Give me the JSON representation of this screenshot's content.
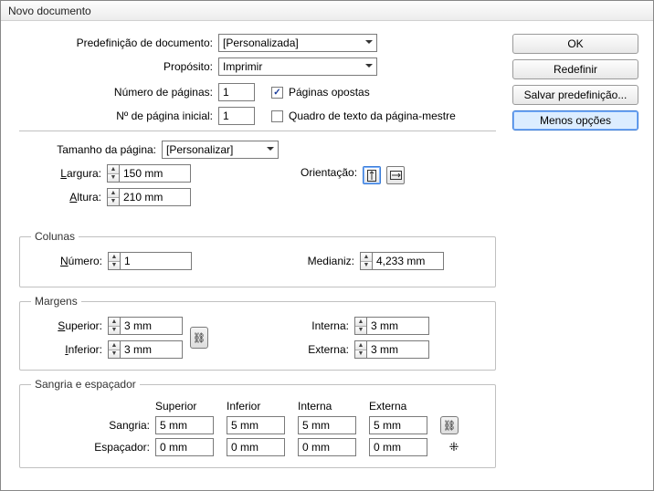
{
  "title": "Novo documento",
  "buttons": {
    "ok": "OK",
    "redefine": "Redefinir",
    "save": "Salvar predefinição...",
    "less": "Menos opções"
  },
  "preset": {
    "label": "Predefinição de documento:",
    "value": "[Personalizada]"
  },
  "intent": {
    "label": "Propósito:",
    "value": "Imprimir"
  },
  "pages": {
    "num_label": "Número de páginas:",
    "num": "1",
    "start_label": "Nº de página inicial:",
    "start": "1"
  },
  "facing": {
    "label": "Páginas opostas",
    "checked": true
  },
  "mastertext": {
    "label": "Quadro de texto da página-mestre",
    "checked": false
  },
  "pagesize": {
    "label": "Tamanho da página:",
    "value": "[Personalizar]",
    "width_label": "Largura:",
    "width": "150 mm",
    "height_label": "Altura:",
    "height": "210 mm",
    "orient_label": "Orientação:"
  },
  "columns": {
    "legend": "Colunas",
    "num_label": "Número:",
    "num": "1",
    "gutter_label": "Medianiz:",
    "gutter": "4,233 mm"
  },
  "margins": {
    "legend": "Margens",
    "top_label": "Superior:",
    "top": "3 mm",
    "bottom_label": "Inferior:",
    "bottom": "3 mm",
    "inner_label": "Interna:",
    "inner": "3 mm",
    "outer_label": "Externa:",
    "outer": "3 mm"
  },
  "bleed": {
    "legend": "Sangria e espaçador",
    "col_top": "Superior",
    "col_bottom": "Inferior",
    "col_inner": "Interna",
    "col_outer": "Externa",
    "bleed_label": "Sangria:",
    "bleed_top": "5 mm",
    "bleed_bottom": "5 mm",
    "bleed_inner": "5 mm",
    "bleed_outer": "5 mm",
    "slug_label": "Espaçador:",
    "slug_top": "0 mm",
    "slug_bottom": "0 mm",
    "slug_inner": "0 mm",
    "slug_outer": "0 mm"
  }
}
